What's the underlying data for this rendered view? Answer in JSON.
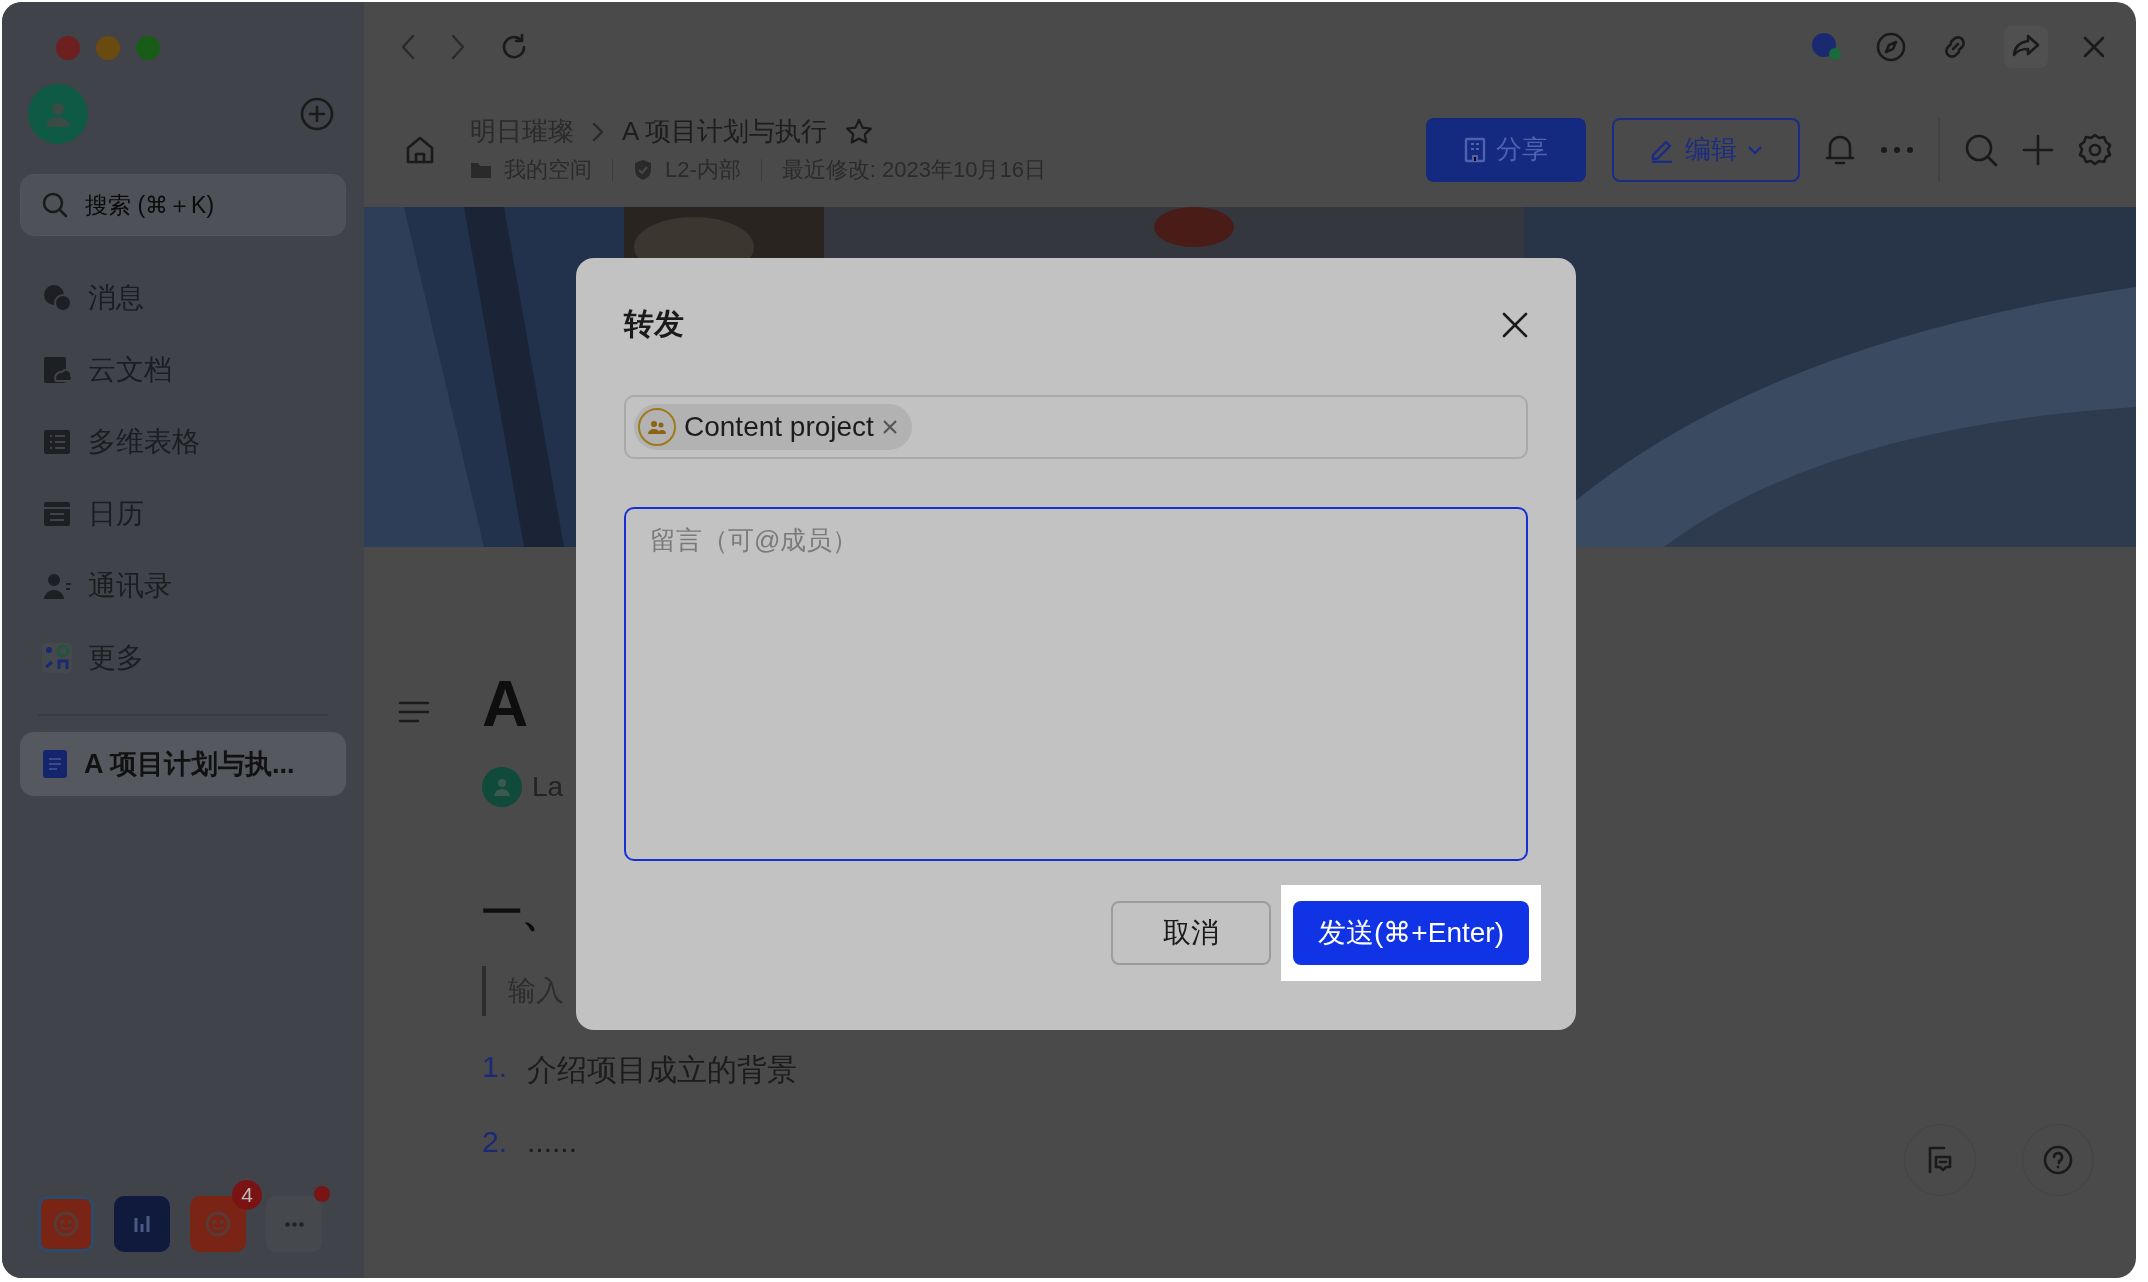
{
  "sidebar": {
    "search": {
      "placeholder": "搜索 (⌘＋K)"
    },
    "nav": [
      {
        "kind": "chat",
        "label": "消息"
      },
      {
        "kind": "docs",
        "label": "云文档"
      },
      {
        "kind": "base",
        "label": "多维表格"
      },
      {
        "kind": "calendar",
        "label": "日历"
      },
      {
        "kind": "contacts",
        "label": "通讯录"
      },
      {
        "kind": "apps",
        "label": "更多"
      }
    ],
    "recent": [
      {
        "label": "A 项目计划与执...",
        "selected": true
      }
    ],
    "dock": [
      {
        "kind": "bot",
        "selected": true,
        "dot": false
      },
      {
        "kind": "chart",
        "selected": false,
        "dot": false
      },
      {
        "kind": "bot",
        "selected": false,
        "dot": false,
        "badge": "4"
      },
      {
        "kind": "more",
        "selected": false,
        "dot": true
      }
    ]
  },
  "header": {
    "breadcrumb": [
      "明日璀璨",
      "A 项目计划与执行"
    ],
    "starred": false,
    "space": "我的空间",
    "security": "L2-内部",
    "modified": "最近修改: 2023年10月16日",
    "share_button": "分享",
    "edit_button": "编辑"
  },
  "document": {
    "heading": "A",
    "author": "La",
    "section": "一、",
    "quote": "输入",
    "list": [
      {
        "number": "1.",
        "text": "介绍项目成立的背景"
      },
      {
        "number": "2.",
        "text": "......"
      }
    ]
  },
  "dialog": {
    "title": "转发",
    "recipients": [
      {
        "label": "Content project"
      }
    ],
    "message": {
      "placeholder": "留言（可@成员）"
    },
    "cancel_button": "取消",
    "send_button": "发送(⌘+Enter)"
  }
}
